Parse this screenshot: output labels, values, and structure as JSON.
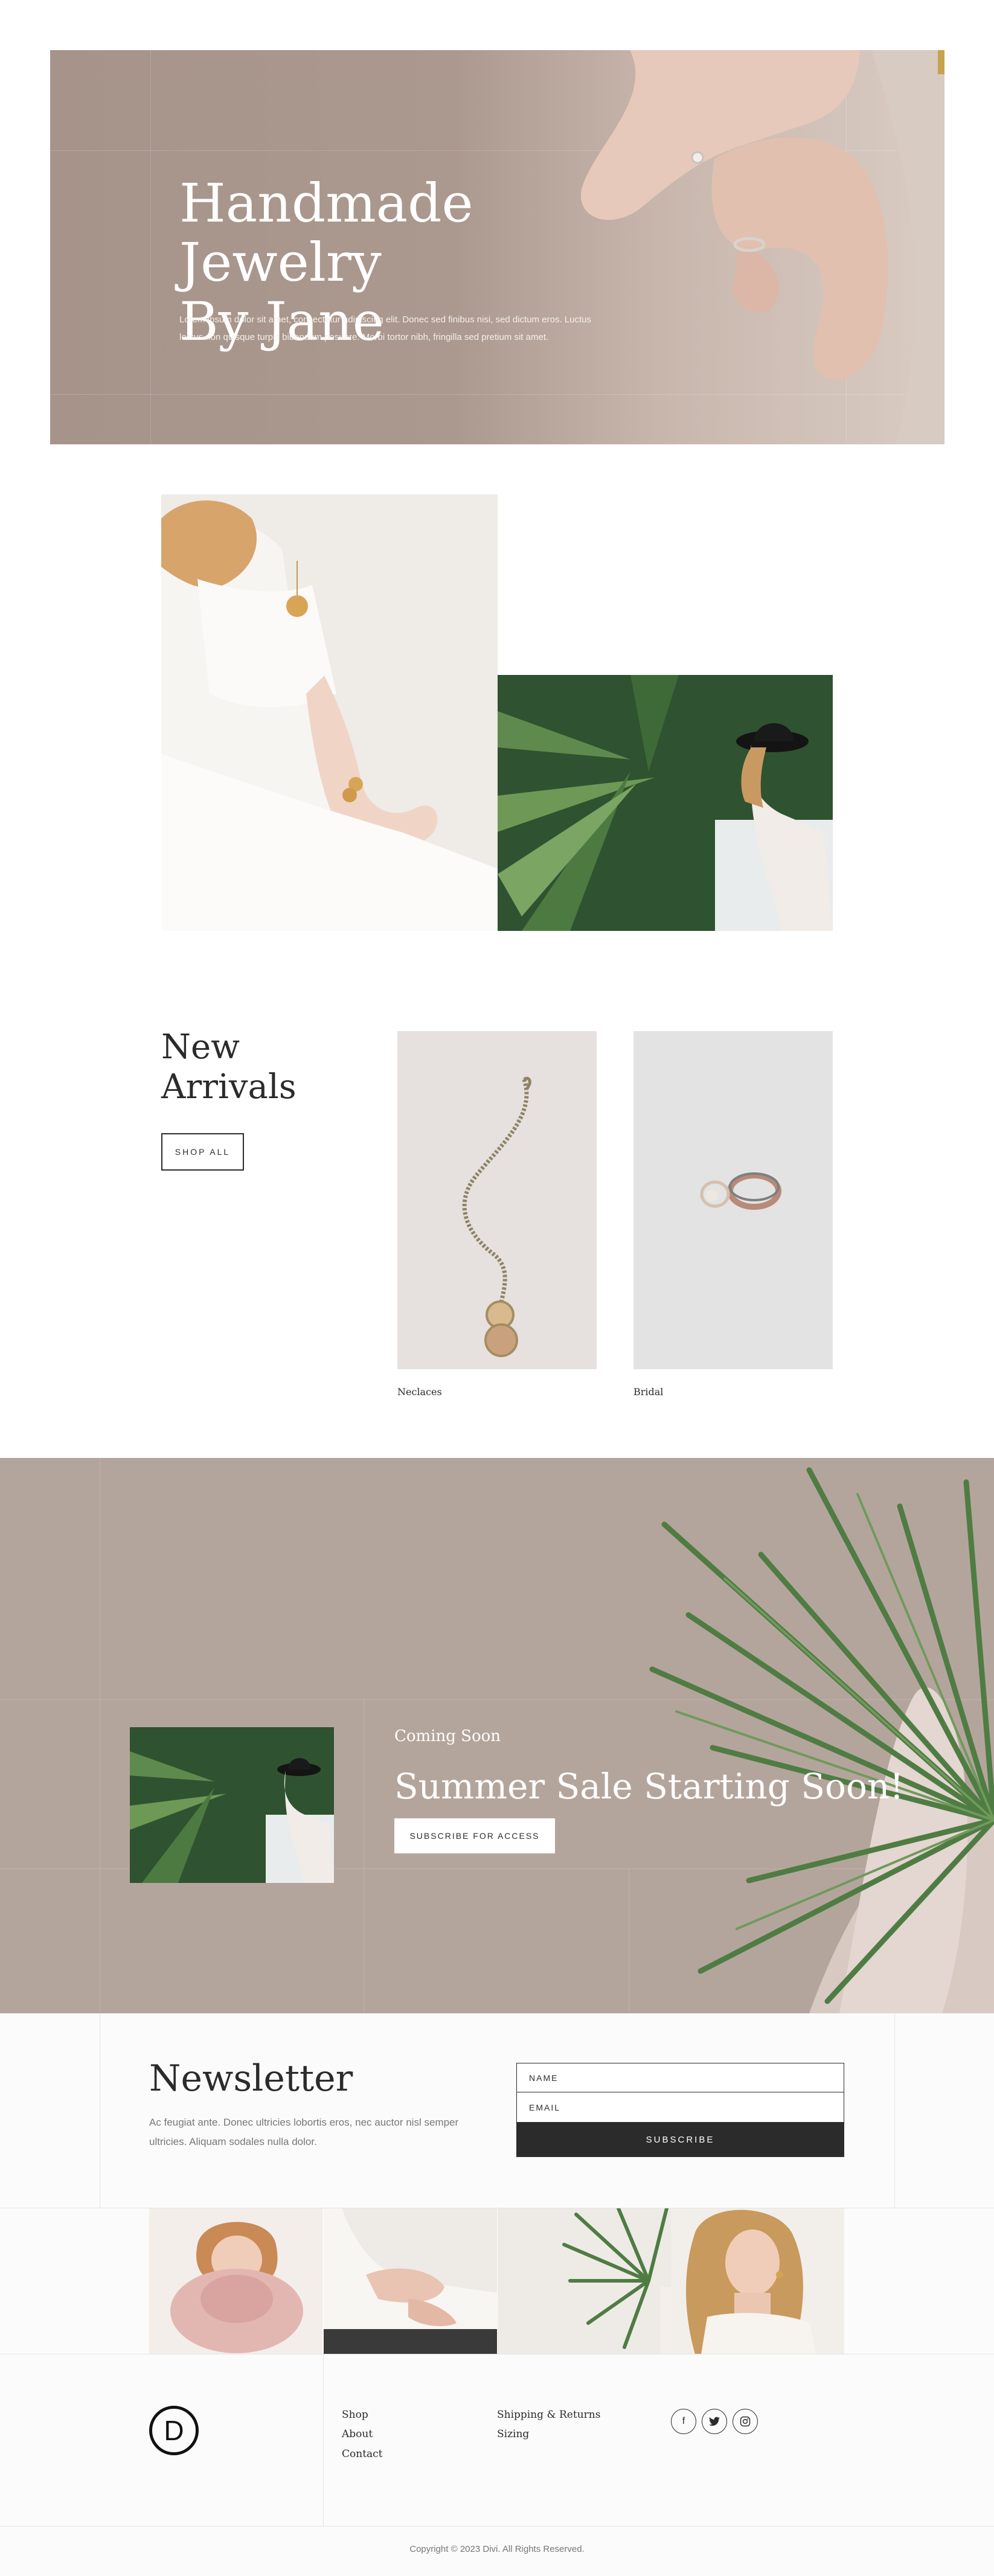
{
  "hero": {
    "title_line1": "Handmade Jewelry",
    "title_line2": "By Jane",
    "text": "Lorem ipsum dolor sit amet, consectetur adipiscing elit. Donec sed finibus nisi, sed dictum eros. Luctus lectus non quisque turpis bibendum posuere. Morbi tortor nibh, fringilla sed pretium sit amet."
  },
  "arrivals": {
    "title_line1": "New",
    "title_line2": "Arrivals",
    "shop_all_label": "SHOP ALL",
    "products": [
      {
        "label": "Neclaces"
      },
      {
        "label": "Bridal"
      }
    ]
  },
  "sale": {
    "subtitle": "Coming Soon",
    "title": "Summer Sale Starting Soon!",
    "button_label": "SUBSCRIBE FOR ACCESS"
  },
  "newsletter": {
    "title": "Newsletter",
    "text": "Ac feugiat ante. Donec ultricies lobortis eros, nec auctor nisl semper ultricies. Aliquam sodales nulla dolor.",
    "name_placeholder": "NAME",
    "email_placeholder": "EMAIL",
    "submit_label": "SUBSCRIBE"
  },
  "footer": {
    "logo_letter": "D",
    "links_col1": [
      "Shop",
      "About",
      "Contact"
    ],
    "links_col2": [
      "Shipping & Returns",
      "Sizing"
    ],
    "social": [
      "facebook-icon",
      "twitter-icon",
      "instagram-icon"
    ],
    "copyright": "Copyright © 2023 Divi. All Rights Reserved."
  },
  "colors": {
    "hero_bg": "#a6948a",
    "sale_bg": "#b4a59c",
    "dark": "#2b2b2b",
    "leaf_green": "#3f6b3a"
  }
}
